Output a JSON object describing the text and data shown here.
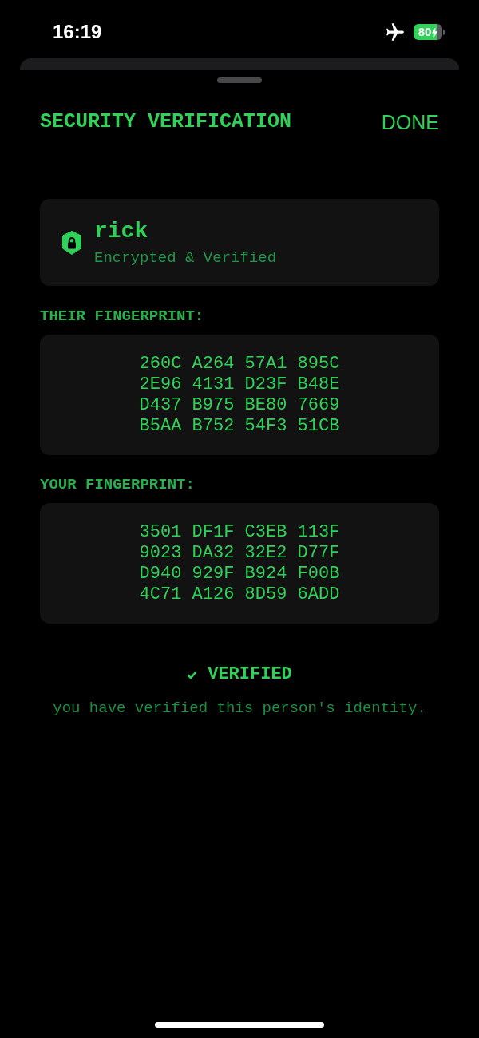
{
  "status_bar": {
    "time": "16:19",
    "airplane_mode": true,
    "battery": "80",
    "charging": true
  },
  "sheet": {
    "title": "SECURITY VERIFICATION",
    "done_button": "DONE"
  },
  "contact": {
    "name": "rick",
    "status": "Encrypted & Verified"
  },
  "fingerprints": [
    {
      "label": "THEIR FINGERPRINT:",
      "lines": [
        "260C A264 57A1 895C",
        "2E96 4131 D23F B48E",
        "D437 B975 BE80 7669",
        "B5AA B752 54F3 51CB"
      ]
    },
    {
      "label": "YOUR FINGERPRINT:",
      "lines": [
        "3501 DF1F C3EB 113F",
        "9023 DA32 32E2 D77F",
        "D940 929F B924 F00B",
        "4C71 A126 8D59 6ADD"
      ]
    }
  ],
  "verification": {
    "verified": true,
    "title": "VERIFIED",
    "message": "you have verified this person's identity."
  }
}
